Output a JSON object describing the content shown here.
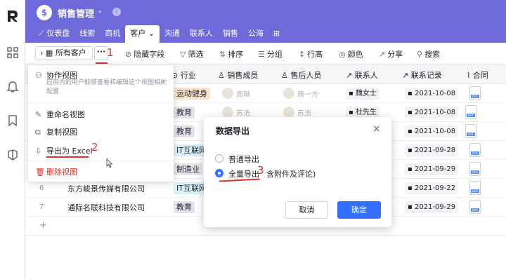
{
  "app": {
    "title": "销售管理",
    "icon": "dollar-circle-icon"
  },
  "tabs": [
    {
      "label": "仪表盘",
      "icon": "chart-icon"
    },
    {
      "label": "线索"
    },
    {
      "label": "商机"
    },
    {
      "label": "客户",
      "active": true
    },
    {
      "label": "沟通"
    },
    {
      "label": "联系人"
    },
    {
      "label": "销售"
    },
    {
      "label": "公海"
    }
  ],
  "toolbar": {
    "view_label": "所有客户",
    "more_label": "···",
    "hide_fields": "隐藏字段",
    "filter": "筛选",
    "sort": "排序",
    "group": "分组",
    "row_height": "行高",
    "color": "颜色",
    "share": "分享",
    "search": "搜索"
  },
  "annotations": {
    "a1": "1",
    "a2": "2",
    "a3": "3"
  },
  "columns": {
    "industry": "行业",
    "sales": "销售成员",
    "after_sales": "售后人员",
    "contact": "联系人",
    "record": "联系记录",
    "contract": "合同"
  },
  "rows": [
    {
      "num": "",
      "name": "",
      "industry": "运动健身",
      "industry_color": "#fde2c9",
      "sales": "周琳",
      "after": "唐一方",
      "contact": "魏女士",
      "record": "2021-10-08"
    },
    {
      "num": "",
      "name": "",
      "industry": "教育",
      "industry_color": "#e5e0ec",
      "sales": "苏浩",
      "after": "苏浩",
      "contact": "杜先生",
      "record": "2021-10-08"
    },
    {
      "num": "",
      "name": "",
      "industry": "教育",
      "industry_color": "#e5e0ec",
      "sales": "",
      "after": "",
      "contact": "",
      "record": "2021-10-08"
    },
    {
      "num": "",
      "name": "",
      "industry": "IT互联网",
      "industry_color": "#d9f0fb",
      "sales": "",
      "after": "",
      "contact": "",
      "record": "2021-09-28"
    },
    {
      "num": "",
      "name": "",
      "industry": "制造业",
      "industry_color": "#e3e6ea",
      "sales": "",
      "after": "",
      "contact": "",
      "record": "2021-09-29"
    },
    {
      "num": "6",
      "name": "东方峻景传媒有限公司",
      "industry": "IT互联网",
      "industry_color": "#d9f0fb",
      "sales": "",
      "after": "",
      "contact": "",
      "record": "2021-09-22"
    },
    {
      "num": "7",
      "name": "通际名联科技有限公司",
      "industry": "教育",
      "industry_color": "#e5e0ec",
      "sales": "",
      "after": "",
      "contact": "",
      "record": "2021-09-29"
    }
  ],
  "add_row": "+",
  "menu": {
    "collab_view": "协作视图",
    "collab_desc": "应用内的用户能够查看和编辑这个视图相关配置",
    "rename_view": "重命名视图",
    "copy_view": "复制视图",
    "export_excel": "导出为 Excel",
    "delete_view": "删除视图"
  },
  "dialog": {
    "title": "数据导出",
    "close": "×",
    "option_normal": "普通导出",
    "option_full": "全量导出",
    "option_full_suffix": "含附件及评论)",
    "selected": "option_full",
    "cancel": "取消",
    "confirm": "确定"
  },
  "colors": {
    "brand": "#6f6ad9",
    "primary": "#3370ff",
    "danger": "#e0302c"
  }
}
